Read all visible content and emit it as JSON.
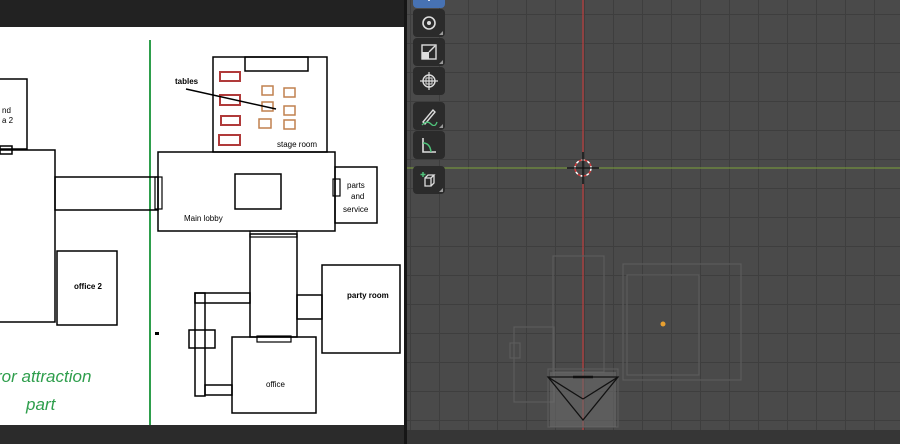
{
  "floorplan": {
    "tables_label": "tables",
    "stage_room": "stage room",
    "main_lobby": "Main lobby",
    "parts_line1": "parts",
    "parts_line2": "and",
    "parts_line3": "service",
    "office2": "office 2",
    "party_room": "party room",
    "office": "office",
    "left_partial_line1": "nd",
    "left_partial_line2": "a 2",
    "attraction_line1": "ror attraction",
    "attraction_line2": "part"
  },
  "colors": {
    "green": "#2e9e4c",
    "table_red": "#b03a3a",
    "table_orange": "#c0814f",
    "axis_red": "#d43a3a",
    "axis_green": "#7ca33a",
    "active_tool": "#4772b3"
  },
  "viewport": {
    "tools": [
      "transform-icon",
      "rotate-icon",
      "scale-icon",
      "transform-all-icon",
      "annotate-icon",
      "measure-icon",
      "add-cube-icon"
    ]
  }
}
